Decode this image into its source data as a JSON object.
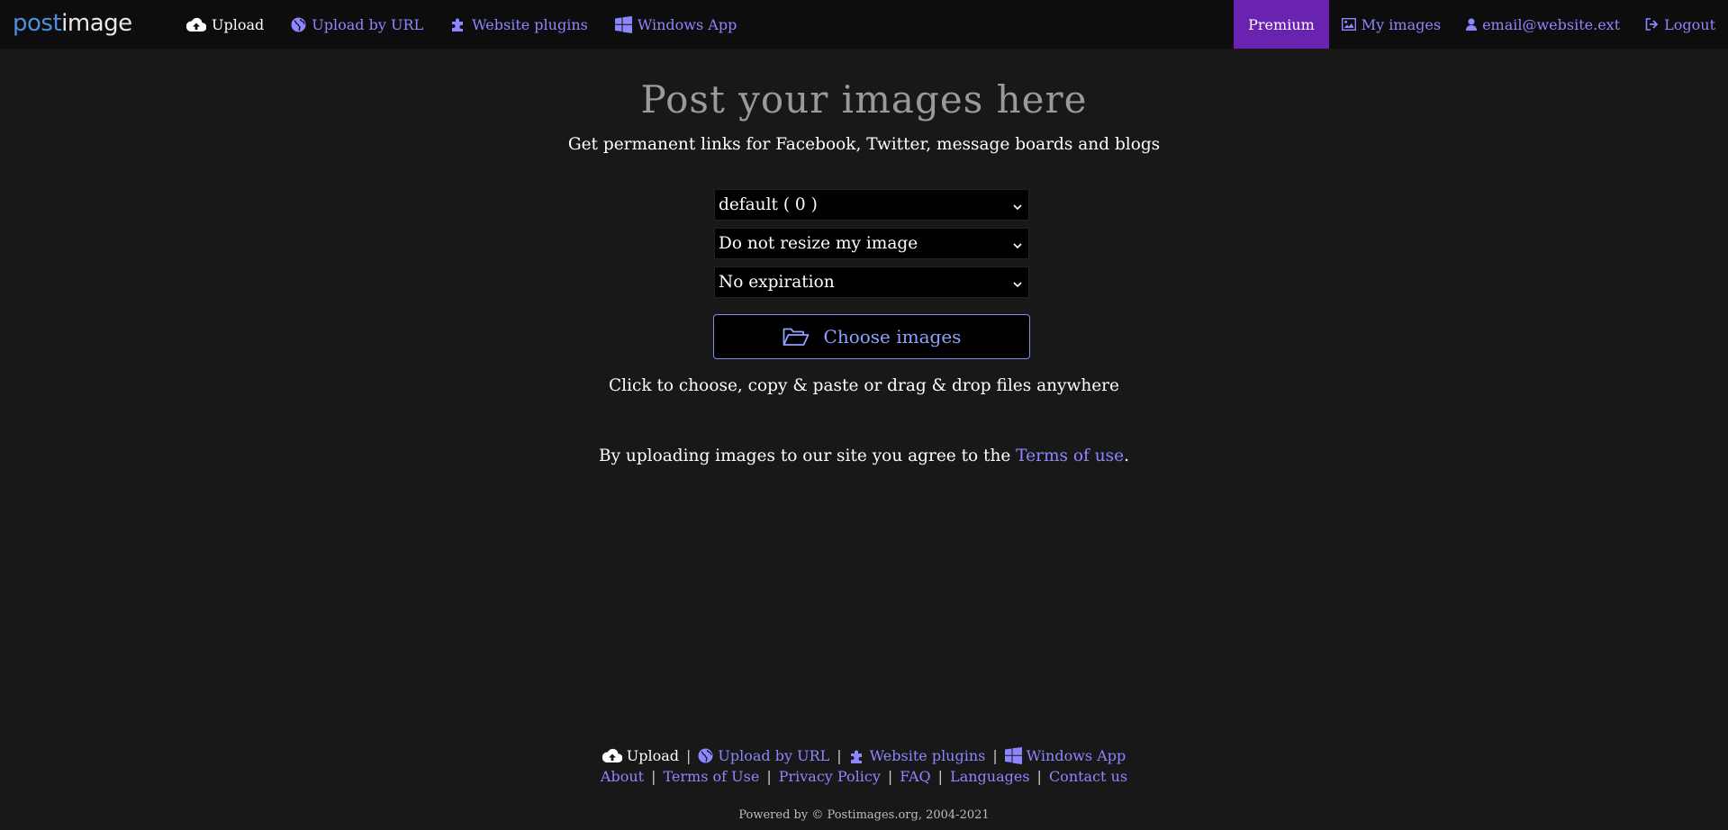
{
  "colors": {
    "background": "#181818",
    "navbar": "#0d0d0d",
    "link": "#8e86ff",
    "premium": "#6a22b0",
    "title": "#9a9a9a",
    "button_border": "#7d8ef0"
  },
  "logo": {
    "part1": "post",
    "part2": "image"
  },
  "nav": {
    "left": [
      {
        "label": "Upload",
        "icon": "cloud-upload-icon"
      },
      {
        "label": "Upload by URL",
        "icon": "globe-icon"
      },
      {
        "label": "Website plugins",
        "icon": "puzzle-icon"
      },
      {
        "label": "Windows App",
        "icon": "windows-icon"
      }
    ],
    "right": [
      {
        "label": "Premium"
      },
      {
        "label": "My images",
        "icon": "image-icon"
      },
      {
        "label": "email@website.ext",
        "icon": "user-icon"
      },
      {
        "label": "Logout",
        "icon": "logout-icon"
      }
    ]
  },
  "main": {
    "title": "Post your images here",
    "subtitle": "Get permanent links for Facebook, Twitter, message boards and blogs",
    "selects": {
      "gallery": "default ( 0 )",
      "resize": "Do not resize my image",
      "expiration": "No expiration"
    },
    "choose_button": "Choose images",
    "hint": "Click to choose, copy & paste or drag & drop files anywhere",
    "terms_prefix": "By uploading images to our site you agree to the",
    "terms_link": "Terms of use",
    "terms_suffix": "."
  },
  "footer": {
    "row1": [
      {
        "label": "Upload",
        "icon": "cloud-upload-icon"
      },
      {
        "label": "Upload by URL",
        "icon": "globe-icon"
      },
      {
        "label": "Website plugins",
        "icon": "puzzle-icon"
      },
      {
        "label": "Windows App",
        "icon": "windows-icon"
      }
    ],
    "row2": [
      {
        "label": "About"
      },
      {
        "label": "Terms of Use"
      },
      {
        "label": "Privacy Policy"
      },
      {
        "label": "FAQ"
      },
      {
        "label": "Languages"
      },
      {
        "label": "Contact us"
      }
    ],
    "separator": "|",
    "powered": "Powered by © Postimages.org, 2004-2021"
  }
}
